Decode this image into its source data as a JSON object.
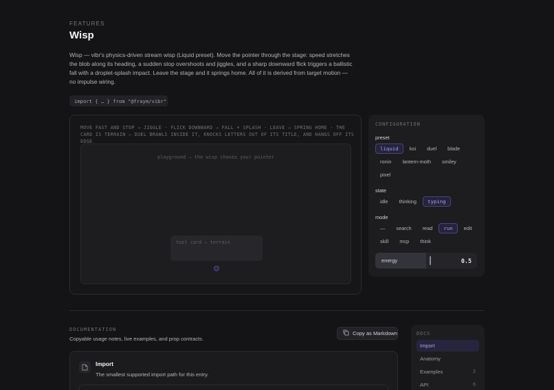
{
  "header": {
    "eyebrow": "FEATURES",
    "title": "Wisp",
    "description": "Wisp — vibr's physics-driven stream wisp (Liquid preset). Move the pointer through the stage: speed stretches the blob along its heading, a sudden stop overshoots and jiggles, and a sharp downward flick triggers a ballistic fall with a droplet-splash impact. Leave the stage and it springs home. All of it is derived from target motion — no impulse wiring.",
    "import_snippet": "import { … } from \"@fraym/vibr\""
  },
  "stage": {
    "instructions": "MOVE FAST AND STOP → JIGGLE · FLICK DOWNWARD → FALL + SPLASH · LEAVE → SPRING HOME · THE CARD IS TERRAIN — DUEL BRAWLS INSIDE IT, KNOCKS LETTERS OUT OF ITS TITLE, AND HANGS OFF ITS EDGE",
    "playground_label": "playground — the wisp chases your pointer",
    "tool_card_label": "tool card — terrain"
  },
  "config": {
    "title": "CONFIGURATION",
    "preset_label": "preset",
    "preset_rows": [
      [
        {
          "label": "liquid",
          "selected": true
        },
        {
          "label": "koi"
        },
        {
          "label": "duel"
        },
        {
          "label": "blade"
        }
      ],
      [
        {
          "label": "ronin"
        },
        {
          "label": "lantern-moth"
        },
        {
          "label": "smiley"
        }
      ],
      [
        {
          "label": "pixel"
        }
      ]
    ],
    "state_label": "state",
    "state_rows": [
      [
        {
          "label": "idle"
        },
        {
          "label": "thinking"
        },
        {
          "label": "typing",
          "selected": true
        }
      ]
    ],
    "mode_label": "mode",
    "mode_rows": [
      [
        {
          "label": "—"
        },
        {
          "label": "search"
        },
        {
          "label": "read"
        },
        {
          "label": "run",
          "selected": true
        },
        {
          "label": "edit"
        }
      ],
      [
        {
          "label": "skill"
        },
        {
          "label": "mcp"
        },
        {
          "label": "think"
        }
      ]
    ],
    "energy_label": "energy",
    "energy_value": "0.5",
    "accent_color": "#a6a0e8"
  },
  "docs": {
    "eyebrow": "DOCUMENTATION",
    "subtitle": "Copyable usage notes, live examples, and prop contracts.",
    "copy_button": "Copy as Markdown",
    "card": {
      "title": "Import",
      "description": "The smallest supported import path for this entry.",
      "icon": "file-icon"
    },
    "nav_title": "DOCS",
    "nav_items": [
      {
        "label": "Import",
        "active": true,
        "count": ""
      },
      {
        "label": "Anatomy",
        "count": ""
      },
      {
        "label": "Examples",
        "count": "2"
      },
      {
        "label": "API",
        "count": "6"
      }
    ]
  }
}
